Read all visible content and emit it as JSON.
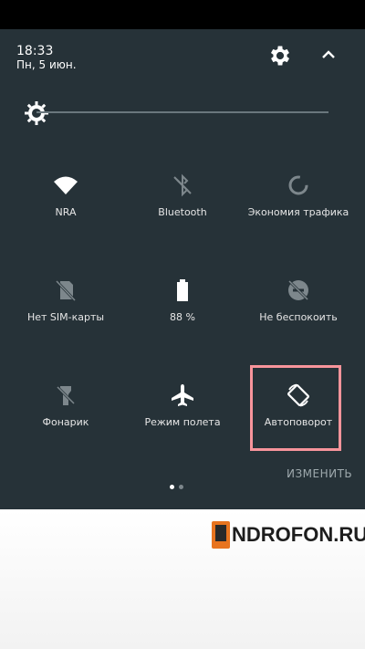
{
  "header": {
    "time": "18:33",
    "date": "Пн, 5 июн."
  },
  "tiles": [
    {
      "label": "NRA",
      "icon": "wifi-icon",
      "active": true
    },
    {
      "label": "Bluetooth",
      "icon": "bluetooth-off-icon",
      "active": false
    },
    {
      "label": "Экономия трафика",
      "icon": "data-saver-icon",
      "active": false
    },
    {
      "label": "Нет SIM-карты",
      "icon": "no-sim-icon",
      "active": false
    },
    {
      "label": "88 %",
      "icon": "battery-icon",
      "active": true
    },
    {
      "label": "Не беспокоить",
      "icon": "dnd-off-icon",
      "active": false
    },
    {
      "label": "Фонарик",
      "icon": "flashlight-icon",
      "active": false
    },
    {
      "label": "Режим полета",
      "icon": "airplane-icon",
      "active": true
    },
    {
      "label": "Автоповорот",
      "icon": "auto-rotate-icon",
      "active": true
    }
  ],
  "footer": {
    "edit_label": "ИЗМЕНИТЬ",
    "page_count": 2,
    "current_page": 1
  },
  "watermark": {
    "text": "NDROFON.RU"
  },
  "colors": {
    "panel": "#263238",
    "highlight": "#f7949b"
  }
}
